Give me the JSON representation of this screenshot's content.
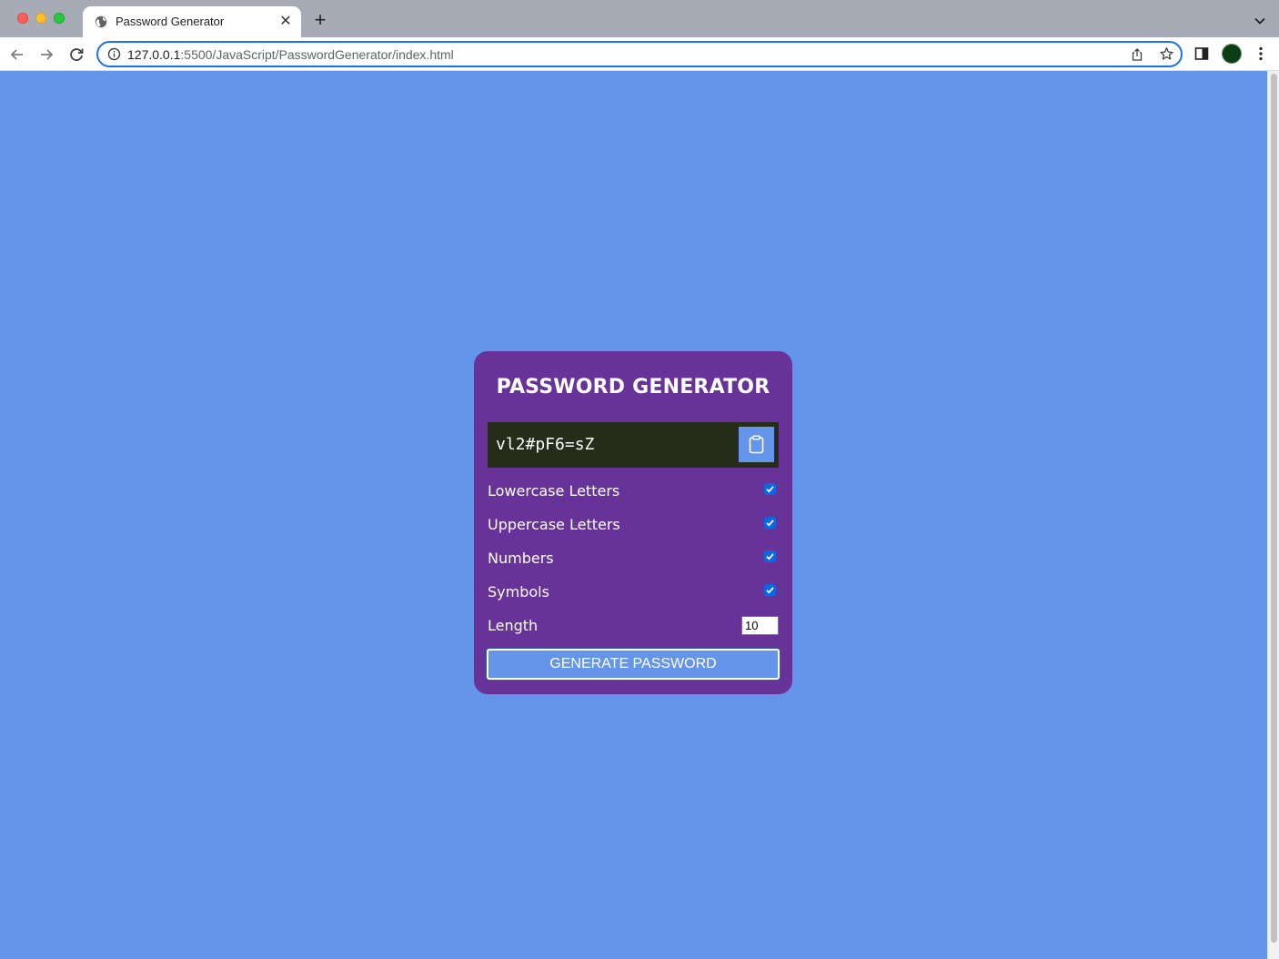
{
  "browser": {
    "tab_title": "Password Generator",
    "tab_close": "✕",
    "new_tab": "+",
    "url_host": "127.0.0.1",
    "url_path": ":5500/JavaScript/PasswordGenerator/index.html",
    "icons": [
      "back-arrow-icon",
      "forward-arrow-icon",
      "reload-icon",
      "info-icon",
      "share-icon",
      "star-icon",
      "side-panel-icon",
      "profile-avatar",
      "kebab-menu-icon",
      "chevron-down-icon"
    ]
  },
  "app": {
    "title": "PASSWORD GENERATOR",
    "password": "vl2#pF6=sZ",
    "clipboard_icon": "clipboard-icon",
    "options": [
      {
        "label": "Lowercase Letters",
        "checked": true
      },
      {
        "label": "Uppercase Letters",
        "checked": true
      },
      {
        "label": "Numbers",
        "checked": true
      },
      {
        "label": "Symbols",
        "checked": true
      }
    ],
    "length_label": "Length",
    "length_value": "10",
    "generate_label": "GENERATE PASSWORD"
  },
  "colors": {
    "page_background": "#6495ea",
    "card_background": "#673399",
    "result_background": "#252c1a",
    "button_background": "#6495ea",
    "checkbox_accent": "#0b67e3"
  }
}
